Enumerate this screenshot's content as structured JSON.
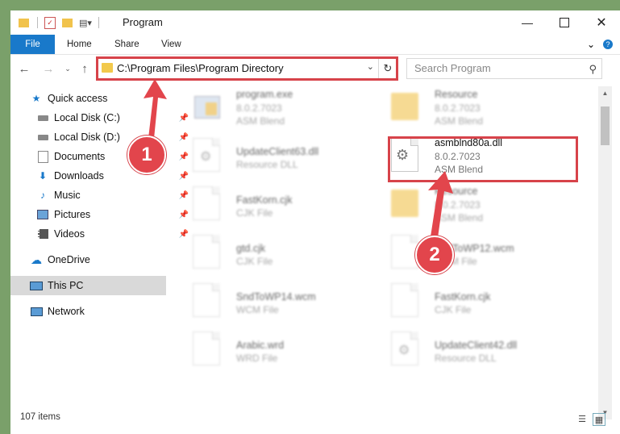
{
  "window": {
    "title": "Program"
  },
  "ribbon": {
    "tabs": [
      "File",
      "Home",
      "Share",
      "View"
    ]
  },
  "nav": {
    "address": "C:\\Program Files\\Program Directory",
    "search_placeholder": "Search Program"
  },
  "sidebar": {
    "items": [
      {
        "label": "Quick access",
        "icon": "star-icon",
        "pinned": false
      },
      {
        "label": "Local Disk (C:)",
        "icon": "drive-icon",
        "pinned": true
      },
      {
        "label": "Local Disk (D:)",
        "icon": "drive-icon",
        "pinned": true
      },
      {
        "label": "Documents",
        "icon": "documents-icon",
        "pinned": true
      },
      {
        "label": "Downloads",
        "icon": "download-icon",
        "pinned": true
      },
      {
        "label": "Music",
        "icon": "music-icon",
        "pinned": true
      },
      {
        "label": "Pictures",
        "icon": "pictures-icon",
        "pinned": true
      },
      {
        "label": "Videos",
        "icon": "videos-icon",
        "pinned": true
      },
      {
        "label": "OneDrive",
        "icon": "cloud-icon",
        "pinned": false
      },
      {
        "label": "This PC",
        "icon": "pc-icon",
        "pinned": false,
        "selected": true
      },
      {
        "label": "Network",
        "icon": "network-icon",
        "pinned": false
      }
    ]
  },
  "files": [
    {
      "name": "program.exe",
      "line2": "8.0.2.7023",
      "line3": "ASM Blend",
      "kind": "exe"
    },
    {
      "name": "Resource",
      "line2": "8.0.2.7023",
      "line3": "ASM Blend",
      "kind": "folder"
    },
    {
      "name": "UpdateClient63.dll",
      "line2": "Resource DLL",
      "line3": "",
      "kind": "dll"
    },
    {
      "name": "asmblnd80a.dll",
      "line2": "8.0.2.7023",
      "line3": "ASM Blend",
      "kind": "dll"
    },
    {
      "name": "FastKorn.cjk",
      "line2": "CJK File",
      "line3": "",
      "kind": "doc"
    },
    {
      "name": "Resource",
      "line2": "8.0.2.7023",
      "line3": "ASM Blend",
      "kind": "folder"
    },
    {
      "name": "gtd.cjk",
      "line2": "CJK File",
      "line3": "",
      "kind": "doc"
    },
    {
      "name": "SndToWP12.wcm",
      "line2": "WCM File",
      "line3": "",
      "kind": "doc"
    },
    {
      "name": "SndToWP14.wcm",
      "line2": "WCM File",
      "line3": "",
      "kind": "doc"
    },
    {
      "name": "FastKorn.cjk",
      "line2": "CJK File",
      "line3": "",
      "kind": "doc"
    },
    {
      "name": "Arabic.wrd",
      "line2": "WRD File",
      "line3": "",
      "kind": "doc"
    },
    {
      "name": "UpdateClient42.dll",
      "line2": "Resource DLL",
      "line3": "",
      "kind": "dll"
    }
  ],
  "status": {
    "count": "107 items"
  },
  "callouts": [
    "1",
    "2"
  ],
  "colors": {
    "accent": "#1979ca",
    "highlight": "#d7434a",
    "folder": "#f1c34c"
  }
}
